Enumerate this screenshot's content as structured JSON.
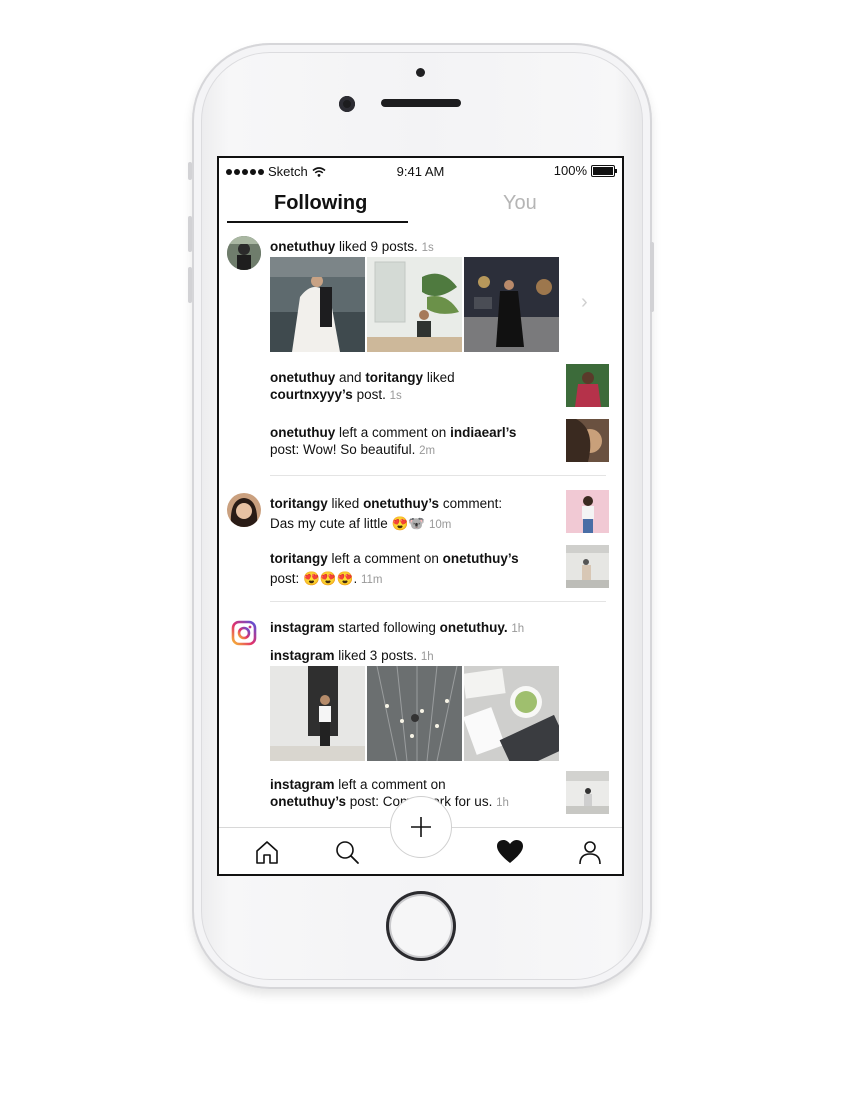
{
  "status_bar": {
    "carrier": "Sketch",
    "time": "9:41 AM",
    "battery": "100%"
  },
  "tabs": {
    "following": "Following",
    "you": "You"
  },
  "feed": {
    "g1": {
      "user": "onetuthuy",
      "text": "liked 9 posts.",
      "time": "1s",
      "row1": {
        "u1": "onetuthuy",
        "and": "and",
        "u2": "toritangy",
        "text": "liked",
        "target": "courtnxyyy’s",
        "post": "post.",
        "time": "1s"
      },
      "row2": {
        "user": "onetuthuy",
        "text": "left a comment on",
        "target": "indiaearl’s",
        "line2": "post: Wow! So beautiful.",
        "time": "2m"
      }
    },
    "g2": {
      "user": "toritangy",
      "text": "liked",
      "target": "onetuthuy’s",
      "text2": "comment:",
      "line2": "Das my cute af little 😍🐨",
      "time": "10m",
      "row1": {
        "user": "toritangy",
        "text": "left a comment on",
        "target": "onetuthuy’s",
        "line2": "post: 😍😍😍.",
        "time": "11m"
      }
    },
    "g3": {
      "user": "instagram",
      "text": "started following",
      "target": "onetuthuy.",
      "time": "1h",
      "sub_user": "instagram",
      "sub_text": "liked 3 posts.",
      "sub_time": "1h",
      "row1": {
        "user": "instagram",
        "text": "left a comment on",
        "target": "onetuthuy’s",
        "line2": "post: Come work for us.",
        "time": "1h"
      }
    }
  },
  "tabbar": {
    "icons": [
      "home-icon",
      "search-icon",
      "plus-icon",
      "heart-icon",
      "profile-icon"
    ]
  },
  "colors": {
    "text": "#111111",
    "muted": "#999999",
    "inactive_tab": "#b5b5b5",
    "divider": "#e4e4e4"
  }
}
